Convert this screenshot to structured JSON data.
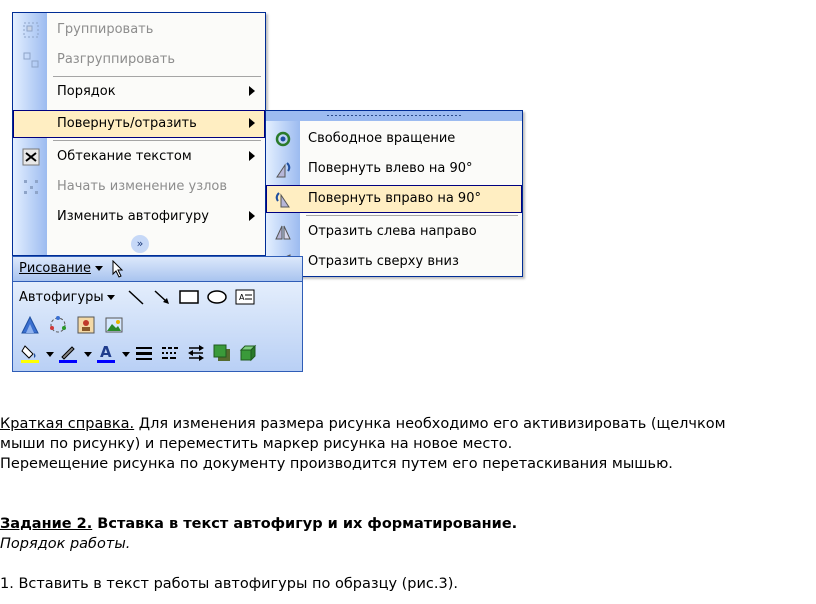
{
  "menu": {
    "items": [
      {
        "label": "Группировать",
        "icon": "group-icon",
        "disabled": true
      },
      {
        "label": "Разгруппировать",
        "icon": "ungroup-icon",
        "disabled": true
      },
      {
        "label": "Порядок",
        "icon": "",
        "disabled": false
      },
      {
        "label": "Повернуть/отразить",
        "icon": "",
        "disabled": false
      },
      {
        "label": "Обтекание текстом",
        "icon": "text-wrap-icon",
        "disabled": false
      },
      {
        "label": "Начать изменение узлов",
        "icon": "edit-points-icon",
        "disabled": true
      },
      {
        "label": "Изменить автофигуру",
        "icon": "",
        "disabled": false
      }
    ]
  },
  "submenu": {
    "items": [
      {
        "label": "Свободное вращение",
        "icon": "free-rotate-icon"
      },
      {
        "label": "Повернуть влево на 90°",
        "icon": "rotate-left-icon"
      },
      {
        "label": "Повернуть вправо на 90°",
        "icon": "rotate-right-icon"
      },
      {
        "label": "Отразить слева направо",
        "icon": "flip-horizontal-icon"
      },
      {
        "label": "Отразить сверху вниз",
        "icon": "flip-vertical-icon"
      }
    ]
  },
  "toolbar": {
    "drawing_label": "Рисование",
    "autoshapes_label": "Автофигуры"
  },
  "colors": {
    "menu_border": "#002d96",
    "highlight": "#ffeec2",
    "gutter": "#9cbbf0"
  },
  "doc": {
    "note_title": "Краткая справка.",
    "note_text": " Для изменения размера рисунка необходимо его активизировать (щелчком",
    "note_line2": "мыши по рисунку) и переместить маркер рисунка на новое место.",
    "note_line3": "Перемещение рисунка по документу производится путем его перетаскивания мышью.",
    "task_label": "Задание 2.",
    "task_title": " Вставка в текст автофигур и их форматирование.",
    "procedure": "Порядок работы.",
    "step1": "1. Вставить в текст работы автофигуры по образцу (рис.3)."
  }
}
